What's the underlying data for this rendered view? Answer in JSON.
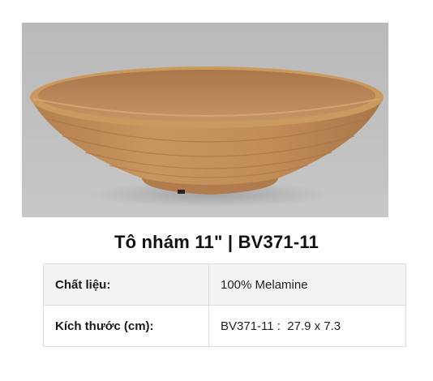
{
  "product": {
    "title": "Tô nhám 11\" | BV371-11",
    "image_alt": "bowl photo"
  },
  "specs": [
    {
      "label": "Chất liệu:",
      "value": "100% Melamine"
    },
    {
      "label": "Kích thước (cm):",
      "value": "BV371-11 :  27.9 x 7.3"
    }
  ],
  "colors": {
    "photo_background": "#bdbdbd",
    "bowl_body": "#c08e5e",
    "bowl_rim": "#c9995f",
    "bowl_inner": "#b7834f",
    "title_text": "#111111",
    "table_border": "#dcdcdc",
    "row_shade": "#f3f3f3"
  }
}
